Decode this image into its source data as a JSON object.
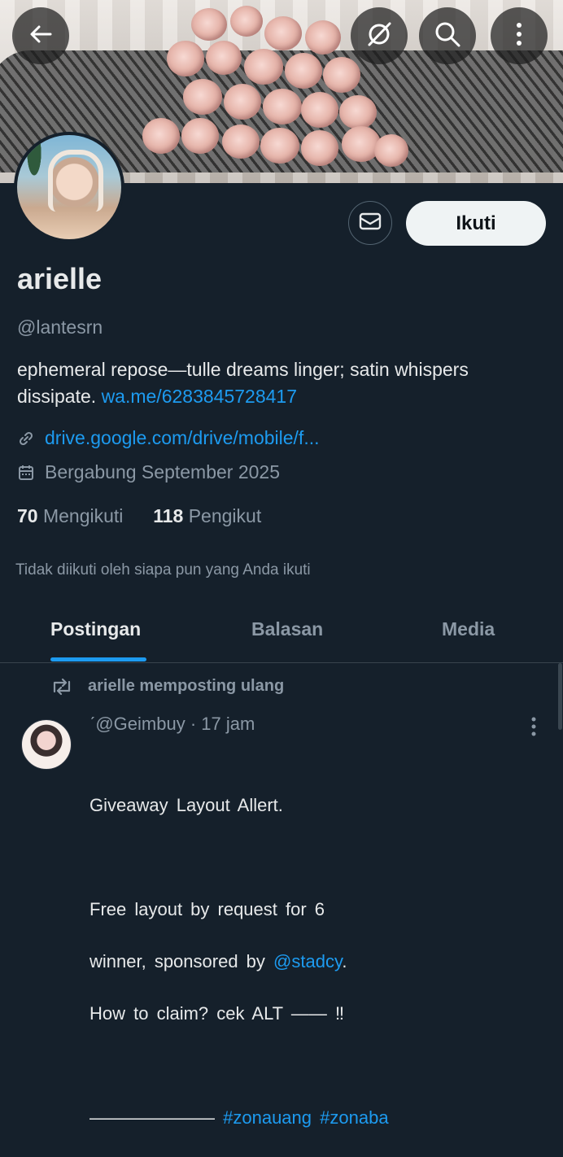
{
  "header": {
    "icons": [
      "back-arrow-icon",
      "grok-icon",
      "search-icon",
      "more-vertical-icon"
    ]
  },
  "profile": {
    "name": "arielle",
    "handle": "@lantesrn",
    "bio_text": "ephemeral repose—tulle dreams linger; satin whispers dissipate.",
    "bio_link": "wa.me/6283845728417",
    "website": "drive.google.com/drive/mobile/f...",
    "joined": "Bergabung September 2025",
    "following_count": "70",
    "following_label": "Mengikuti",
    "followers_count": "118",
    "followers_label": "Pengikut",
    "not_followed_note": "Tidak diikuti oleh siapa pun yang Anda ikuti",
    "follow_button": "Ikuti"
  },
  "tabs": [
    {
      "label": "Postingan",
      "active": true
    },
    {
      "label": "Balasan",
      "active": false
    },
    {
      "label": "Media",
      "active": false
    }
  ],
  "post": {
    "repost_label": "arielle memposting ulang",
    "author_handle": "ˊ@Geimbuy",
    "time": "· 17 jam",
    "line1": "Giveaway  Layout  Allert.",
    "line2a": "Free  layout  by   request    for  6",
    "line2b_pre": "winner,  sponsored  by ",
    "mention": "@stadcy",
    "line2b_post": ".",
    "line3": "How  to  claim?  cek  ALT ――  ‼",
    "line4_prefix": "――――――― ",
    "hashtag1": "#zonauang",
    "hashtag2": "#zonaba"
  },
  "colors": {
    "background": "#15202b",
    "accent": "#1d9bf0",
    "text_primary": "#e7e9ea",
    "text_secondary": "#8b98a5"
  }
}
